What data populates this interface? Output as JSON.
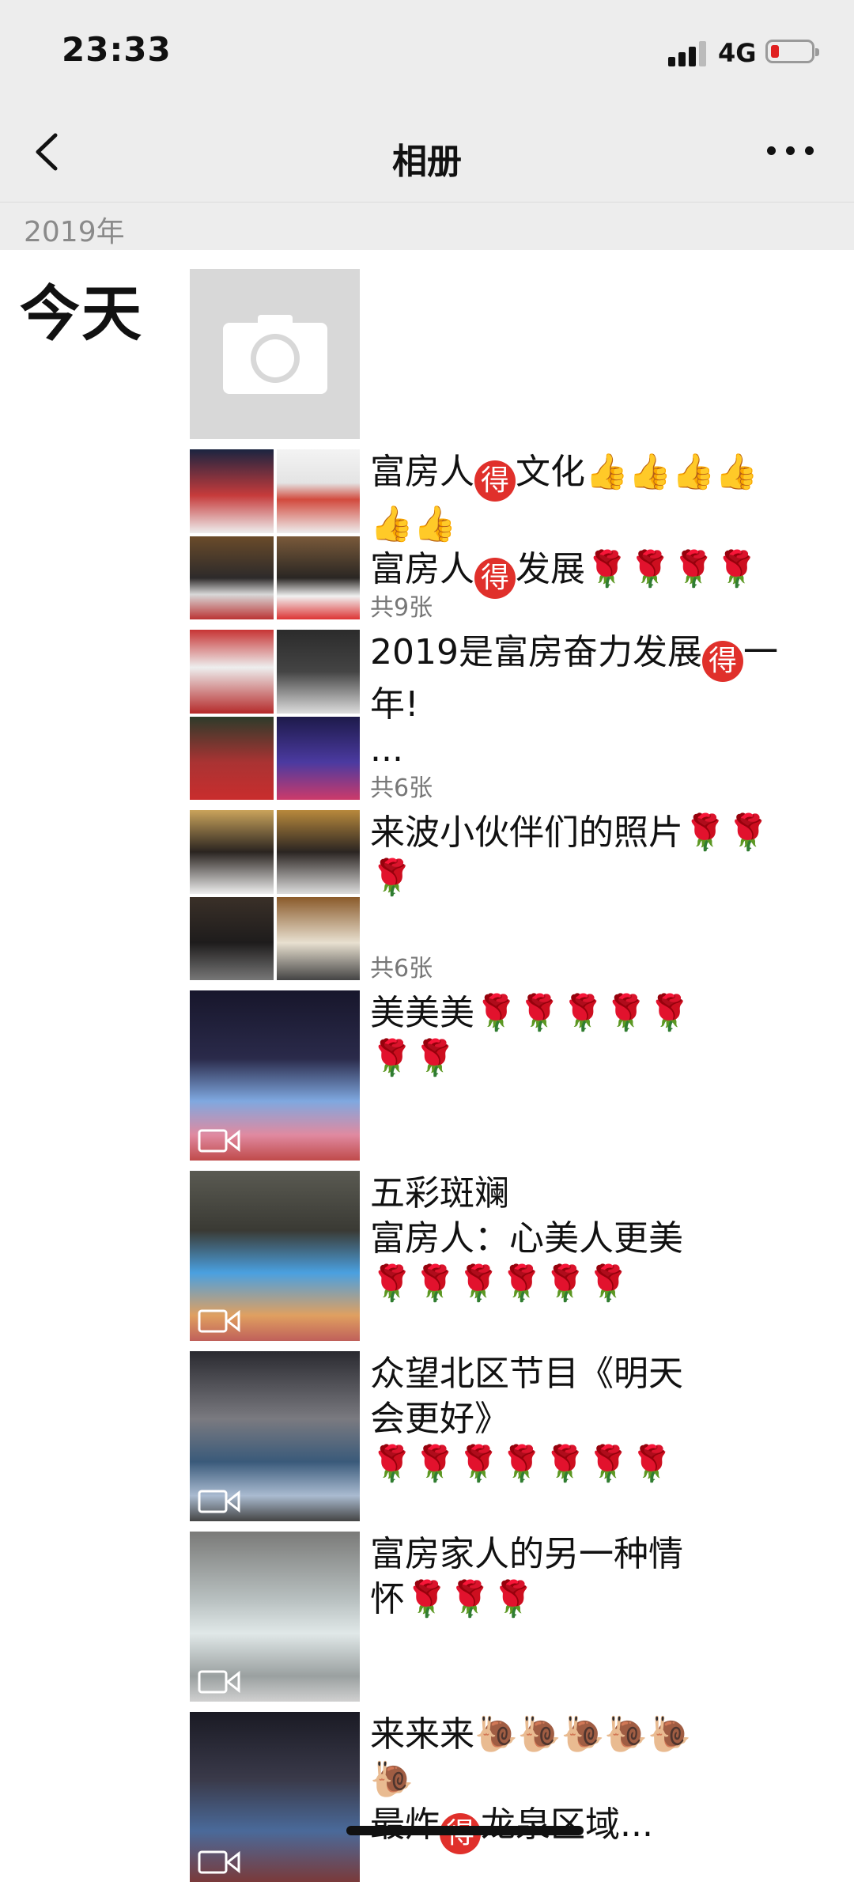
{
  "status": {
    "time": "23:33",
    "network": "4G"
  },
  "nav": {
    "title": "相册"
  },
  "section": {
    "year": "2019年",
    "day": "今天"
  },
  "posts": [
    {
      "lines": [
        "富房人{de}文化👍👍👍👍",
        "👍👍",
        "富房人{de}发展🌹🌹🌹🌹"
      ],
      "count": "共9张"
    },
    {
      "lines": [
        "2019是富房奋力发展{de}一",
        "年!",
        "..."
      ],
      "count": "共6张"
    },
    {
      "lines": [
        "来波小伙伴们的照片🌹🌹",
        "🌹"
      ],
      "count": "共6张"
    },
    {
      "lines": [
        "美美美🌹🌹🌹🌹🌹",
        "🌹🌹"
      ],
      "count": ""
    },
    {
      "lines": [
        "五彩斑斓",
        "富房人：心美人更美",
        "🌹🌹🌹🌹🌹🌹"
      ],
      "count": ""
    },
    {
      "lines": [
        "众望北区节目《明天",
        "会更好》",
        "🌹🌹🌹🌹🌹🌹🌹"
      ],
      "count": ""
    },
    {
      "lines": [
        "富房家人的另一种情",
        "怀🌹🌹🌹"
      ],
      "count": ""
    },
    {
      "lines": [
        "来来来🐌🐌🐌🐌🐌",
        "🐌",
        "最炸{de}龙泉区域..."
      ],
      "count": ""
    }
  ],
  "badge": "得",
  "icons": {
    "back": "chevron-left-icon",
    "more": "more-dots-icon",
    "camera": "camera-icon",
    "video": "video-icon"
  },
  "colors": {
    "bar": "#ededed",
    "badge_red": "#e0302b",
    "muted": "#8a8a8a"
  }
}
